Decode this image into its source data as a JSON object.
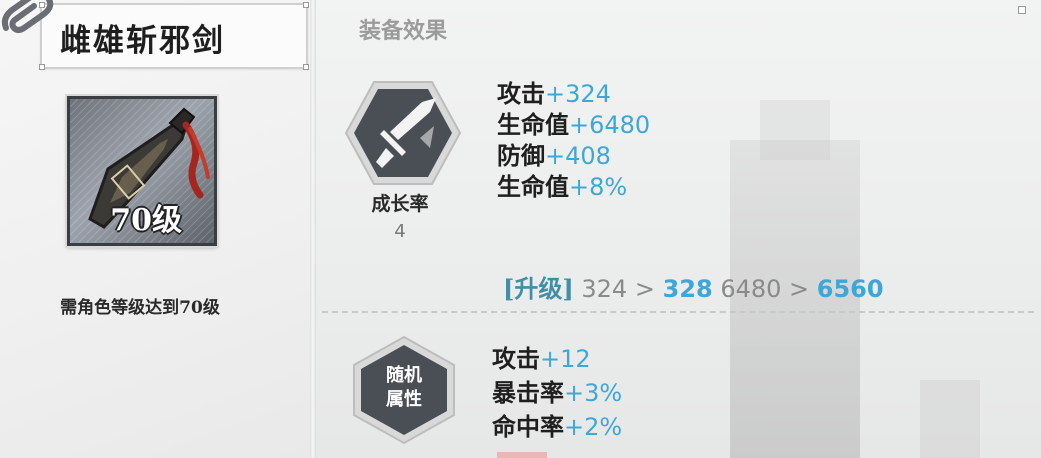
{
  "weapon": {
    "name": "雌雄斩邪剑",
    "level_badge": "70级",
    "requirement": "需角色等级达到70级"
  },
  "effects": {
    "section_title": "装备效果",
    "growth": {
      "label": "成长率",
      "value": "4",
      "icon": "sword-hex-icon",
      "stats": [
        {
          "name": "攻击",
          "value": "+324"
        },
        {
          "name": "生命值",
          "value": "+6480"
        },
        {
          "name": "防御",
          "value": "+408"
        },
        {
          "name": "生命值",
          "value": "+8%"
        }
      ]
    },
    "upgrade": {
      "tag": "[升级]",
      "attack_old": "324",
      "attack_new": "328",
      "hp_old": "6480",
      "hp_new": "6560",
      "arrow": ">"
    },
    "random": {
      "label_line1": "随机",
      "label_line2": "属性",
      "stats": [
        {
          "name": "攻击",
          "value": "+12"
        },
        {
          "name": "暴击率",
          "value": "+3%"
        },
        {
          "name": "命中率",
          "value": "+2%"
        }
      ]
    }
  },
  "colors": {
    "stat_value": "#3fa7d8",
    "upgrade_tag": "#3f8fa6",
    "hex_dark": "#4a4e55",
    "title_gray": "#9b9b9b"
  }
}
